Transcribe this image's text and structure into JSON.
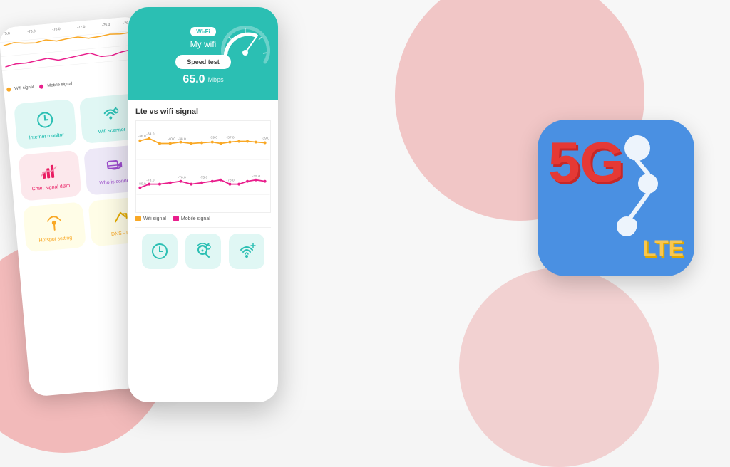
{
  "background": {
    "color": "#f7f7f7"
  },
  "phone_left": {
    "legend": {
      "wifi_label": "Wifi signal",
      "mobile_label": "Mobile signal"
    },
    "features": [
      {
        "id": "internet-monitor",
        "label": "Internet monitor",
        "color": "teal",
        "icon": "⊙"
      },
      {
        "id": "wifi-scanner",
        "label": "Wifi scanner",
        "color": "teal",
        "icon": "⊕"
      },
      {
        "id": "chart-signal",
        "label": "Chart signal dBm",
        "color": "pink",
        "icon": "📶"
      },
      {
        "id": "who-connected",
        "label": "Who is connect",
        "color": "purple",
        "icon": "🖥"
      },
      {
        "id": "hotspot",
        "label": "Hotspot setting",
        "color": "yellow",
        "icon": "📡"
      },
      {
        "id": "dns-ip",
        "label": "DNS - Ip",
        "color": "yellow",
        "icon": "↗"
      }
    ]
  },
  "phone_middle": {
    "wifi_badge": "Wi-Fi",
    "my_wifi_label": "My wifi",
    "speed_test_btn": "Speed test",
    "speed_value": "65.0",
    "speed_unit": "Mbps",
    "chart_title": "Lte vs wifi signal",
    "wifi_series_label": "Wifi signal",
    "mobile_series_label": "Mobile signal",
    "wifi_values": [
      "-36.0",
      "-34.0",
      "-40.0",
      "-40.0",
      "-38.0",
      "-40.0",
      "-39.0",
      "-38.0",
      "-39.0",
      "-38.0",
      "-37.0",
      "-37.0",
      "-38.0",
      "-39.0"
    ],
    "mobile_values": [
      "-80.0",
      "-78.0",
      "-78.0",
      "-77.0",
      "-76.0",
      "-78.0",
      "-77.0",
      "-76.0",
      "-75.0",
      "-78.0",
      "-78.0",
      "-75.0"
    ]
  },
  "logo": {
    "main_text": "5G",
    "sub_text": "LTE"
  },
  "icons": {
    "wifi_icon": "WiFi",
    "search_icon": "🔍",
    "signal_icon": "📶"
  }
}
